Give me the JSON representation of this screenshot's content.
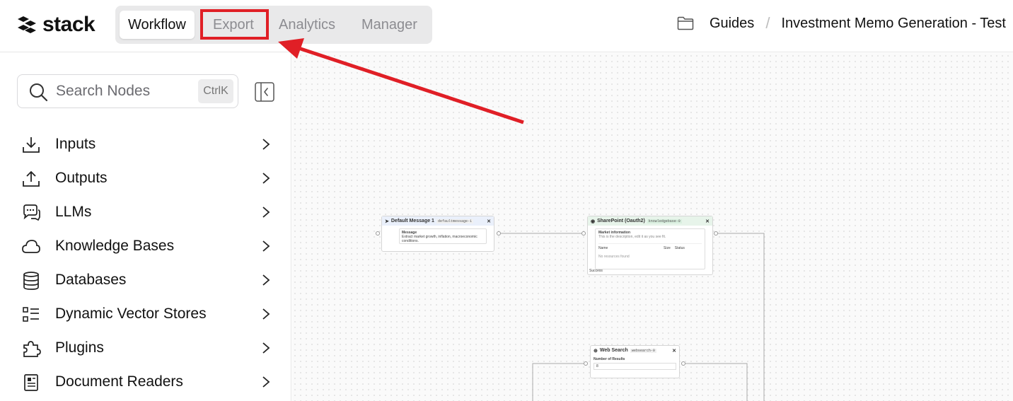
{
  "app": {
    "name": "stack"
  },
  "tabs": [
    {
      "label": "Workflow"
    },
    {
      "label": "Export"
    },
    {
      "label": "Analytics"
    },
    {
      "label": "Manager"
    }
  ],
  "breadcrumb": {
    "folder": "Guides",
    "separator": "/",
    "project": "Investment Memo Generation - Test"
  },
  "sidebar": {
    "search": {
      "placeholder": "Search Nodes",
      "shortcut": "CtrlK"
    },
    "items": [
      {
        "label": "Inputs",
        "icon": "download-icon"
      },
      {
        "label": "Outputs",
        "icon": "upload-icon"
      },
      {
        "label": "LLMs",
        "icon": "chat-bubble-icon"
      },
      {
        "label": "Knowledge Bases",
        "icon": "cloud-icon"
      },
      {
        "label": "Databases",
        "icon": "database-icon"
      },
      {
        "label": "Dynamic Vector Stores",
        "icon": "list-icon"
      },
      {
        "label": "Plugins",
        "icon": "puzzle-icon"
      },
      {
        "label": "Document Readers",
        "icon": "document-icon"
      }
    ]
  },
  "canvas": {
    "nodes": {
      "default_message": {
        "title": "Default Message 1",
        "id": "defaultmessage-1",
        "field_label": "Message",
        "field_value": "Extract market growth, inflation, macroeconomic conditions."
      },
      "sharepoint": {
        "title": "SharePoint (Oauth2)",
        "id": "knowledgebase-0",
        "item_title": "Market information",
        "item_desc": "This is the description, edit it as you see fit.",
        "col_name": "Name",
        "col_size": "Size",
        "col_status": "Status",
        "empty": "No resources found",
        "footer": "Success"
      },
      "web_search": {
        "title": "Web Search",
        "id": "websearch-0",
        "field_label": "Number of Results",
        "field_value": "8"
      }
    }
  },
  "colors": {
    "accent": "#e01f26",
    "active_tab_bg": "#ffffff",
    "tab_bar_bg": "#e9e9ea"
  }
}
